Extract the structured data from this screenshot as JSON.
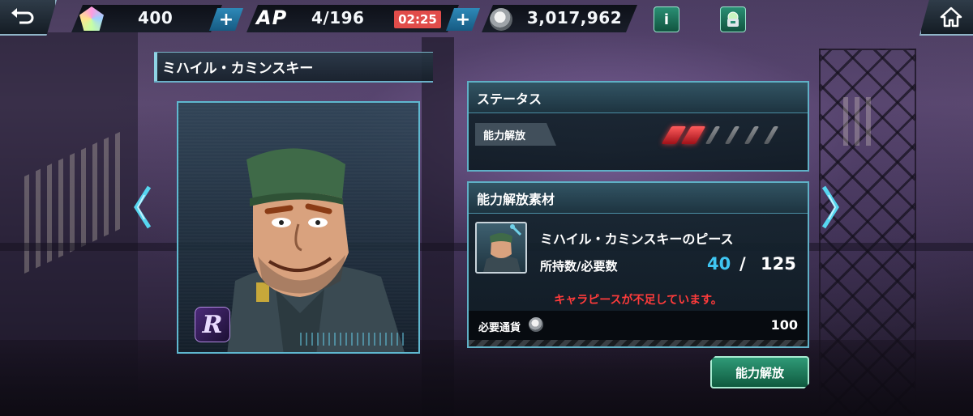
{
  "header": {
    "gems": "400",
    "ap_label": "AP",
    "ap_value": "4/196",
    "ap_timer": "02:25",
    "coins": "3,017,962",
    "plus_symbol": "+",
    "info_label": "i"
  },
  "character": {
    "name": "ミハイル・カミンスキー",
    "rarity": "R"
  },
  "status_panel": {
    "title": "ステータス",
    "unlock_label": "能力解放",
    "unlock_level": 2,
    "unlock_max": 6
  },
  "materials_panel": {
    "title": "能力解放素材",
    "item_name": "ミハイル・カミンスキーのピース",
    "owned_required_label": "所持数/必要数",
    "owned": "40",
    "slash": "/",
    "required": "125",
    "warning": "キャラピースが不足しています。",
    "cost_label": "必要通貨",
    "cost_value": "100"
  },
  "actions": {
    "unlock_button": "能力解放"
  },
  "colors": {
    "accent_cyan": "#5fb8d0",
    "owned_blue": "#3fc6f2",
    "warning_red": "#ff3b3b",
    "timer_red": "#e14c4a",
    "button_green": "#2f9a77"
  },
  "icons": {
    "back": "back-arrow-icon",
    "home": "home-icon",
    "gem": "gem-icon",
    "coin": "coin-icon",
    "info": "info-icon",
    "shop": "shop-bag-icon",
    "prev": "chevron-left-icon",
    "next": "chevron-right-icon"
  }
}
